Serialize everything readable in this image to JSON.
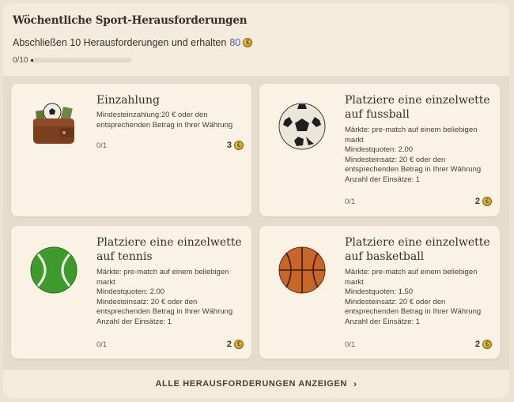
{
  "header": {
    "title": "Wöchentliche Sport-Herausforderungen",
    "subtitle_prefix": "Abschließen 10 Herausforderungen und erhalten",
    "reward_amount": "80",
    "progress_label": "0/10",
    "progress_fraction": 0.0
  },
  "cards": [
    {
      "title": "Einzahlung",
      "desc_lines": [
        "Mindesteinzahlung:20 € oder den",
        "entsprechenden Betrag in Ihrer Währung"
      ],
      "count": "0/1",
      "reward": "3",
      "icon": "wallet-icon"
    },
    {
      "title": "Platziere eine einzelwette auf fussball",
      "desc_lines": [
        "Märkte: pre-match auf einem beliebigen",
        "markt",
        "Mindestquoten: 2.00",
        "Mindesteinsatz: 20 € oder den",
        "entsprechenden Betrag in Ihrer Währung",
        "Anzahl der Einsätze: 1"
      ],
      "count": "0/1",
      "reward": "2",
      "icon": "soccer-ball-icon"
    },
    {
      "title": "Platziere eine einzelwette auf tennis",
      "desc_lines": [
        "Märkte: pre-match auf einem beliebigen",
        "markt",
        "Mindestquoten: 2.00",
        "Mindesteinsatz: 20 € oder den",
        "entsprechenden Betrag in Ihrer Währung",
        "Anzahl der Einsätze: 1"
      ],
      "count": "0/1",
      "reward": "2",
      "icon": "tennis-ball-icon"
    },
    {
      "title": "Platziere eine einzelwette auf basketball",
      "desc_lines": [
        "Märkte: pre-match auf einem beliebigen",
        "markt",
        "Mindestquoten: 1.50",
        "Mindesteinsatz: 20 € oder den",
        "entsprechenden Betrag in Ihrer Währung",
        "Anzahl der Einsätze: 1"
      ],
      "count": "0/1",
      "reward": "2",
      "icon": "basketball-icon"
    }
  ],
  "footer": {
    "link_label": "ALLE HERAUSFORDERUNGEN ANZEIGEN"
  },
  "colors": {
    "accent_blue": "#4a5fb0",
    "coin_gold": "#d9ad32",
    "card_bg": "#f9f2e5"
  }
}
